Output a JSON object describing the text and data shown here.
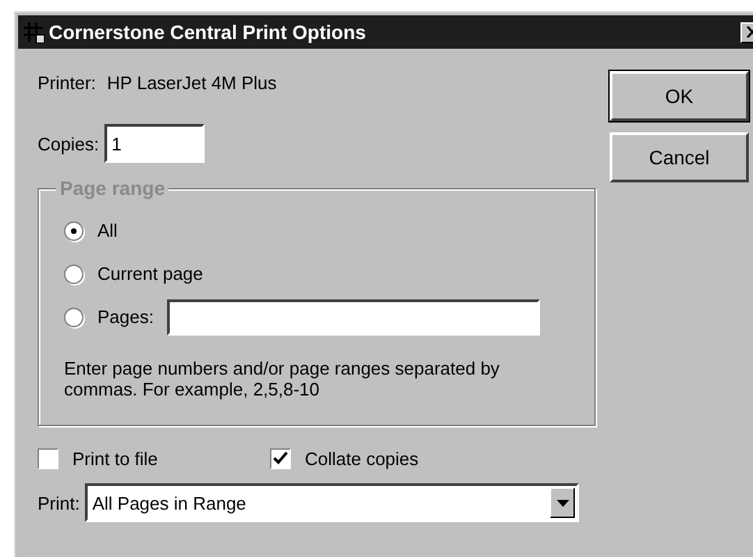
{
  "window": {
    "title": "Cornerstone Central Print Options"
  },
  "printer": {
    "label": "Printer:",
    "value": "HP LaserJet 4M Plus"
  },
  "copies": {
    "label": "Copies:",
    "value": "1"
  },
  "page_range": {
    "title": "Page range",
    "disabled": true,
    "options": [
      {
        "label": "All",
        "selected": true,
        "kind": "plain"
      },
      {
        "label": "Current page",
        "selected": false,
        "kind": "plain"
      },
      {
        "label": "Pages:",
        "selected": false,
        "kind": "field"
      }
    ],
    "hint": "Enter page numbers and/or page ranges separated by commas. For example, 2,5,8-10"
  },
  "options": [
    {
      "label": "Print to file",
      "checked": false
    },
    {
      "label": "Collate copies",
      "checked": true
    }
  ],
  "print": {
    "label": "Print:",
    "value": "All Pages in Range"
  },
  "buttons": [
    {
      "label": "OK",
      "default": true
    },
    {
      "label": "Cancel",
      "default": false
    }
  ]
}
